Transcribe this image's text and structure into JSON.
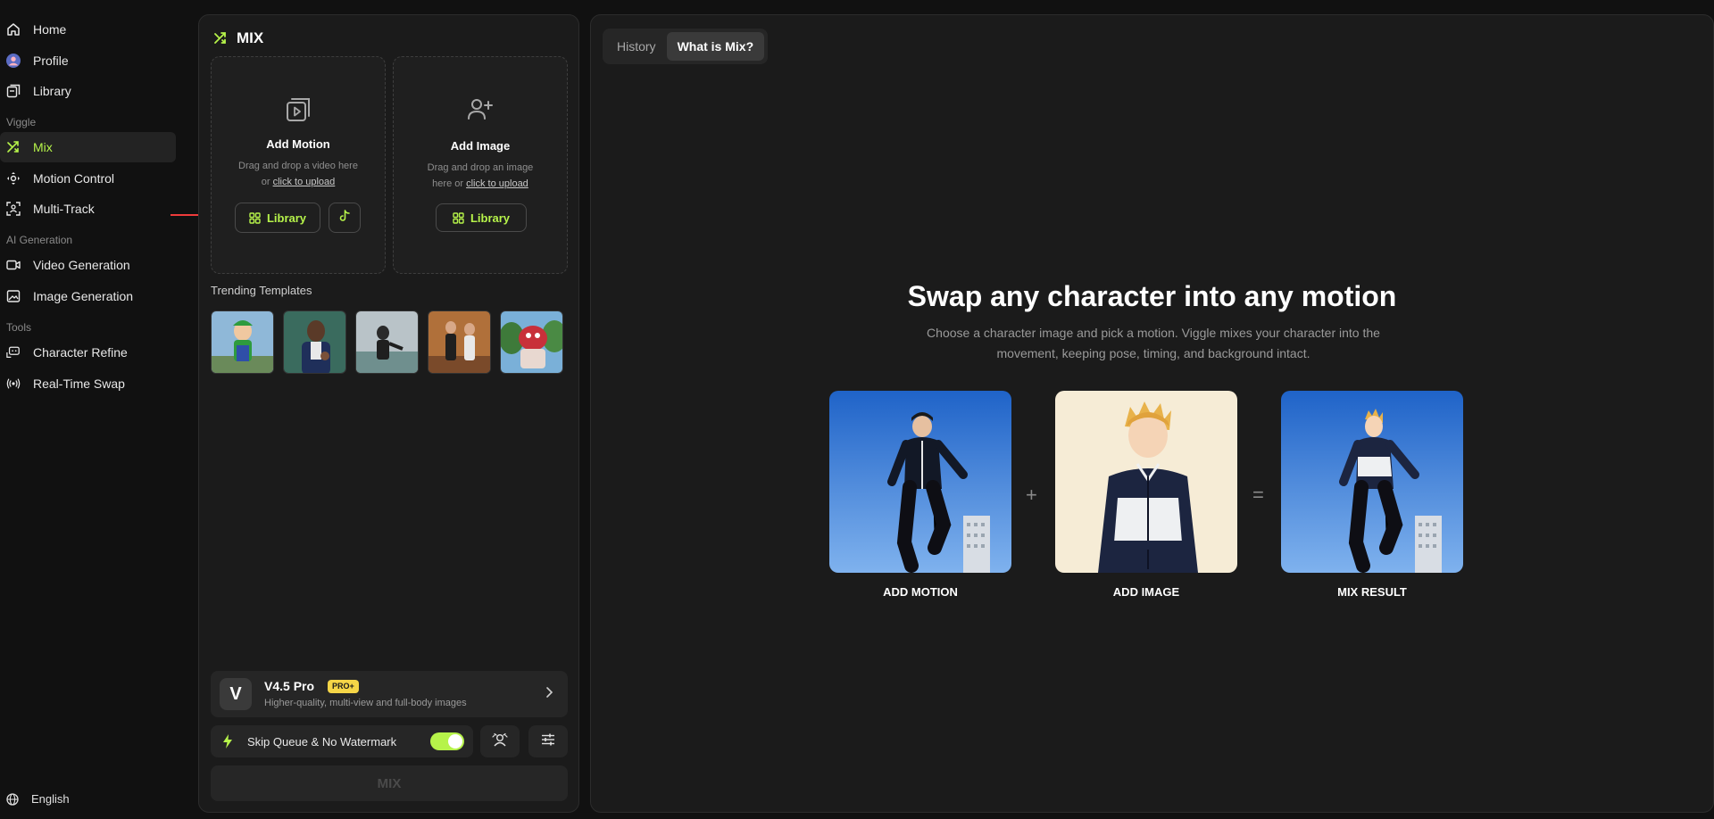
{
  "sidebar": {
    "items": [
      {
        "label": "Home",
        "icon": "home-icon"
      },
      {
        "label": "Profile",
        "icon": "avatar"
      },
      {
        "label": "Library",
        "icon": "library-icon"
      }
    ],
    "sections": [
      {
        "label": "Viggle",
        "items": [
          {
            "label": "Mix",
            "icon": "mix-icon",
            "active": true
          },
          {
            "label": "Motion Control",
            "icon": "motion-control-icon"
          },
          {
            "label": "Multi-Track",
            "icon": "multi-track-icon"
          }
        ]
      },
      {
        "label": "AI Generation",
        "items": [
          {
            "label": "Video Generation",
            "icon": "video-icon"
          },
          {
            "label": "Image Generation",
            "icon": "image-icon"
          }
        ]
      },
      {
        "label": "Tools",
        "items": [
          {
            "label": "Character Refine",
            "icon": "character-refine-icon"
          },
          {
            "label": "Real-Time Swap",
            "icon": "broadcast-icon"
          }
        ]
      }
    ],
    "language": "English"
  },
  "mix_panel": {
    "title": "MIX",
    "add_motion": {
      "title": "Add Motion",
      "sub_line1": "Drag and drop a video here",
      "sub_or": "or",
      "upload_link": "click to upload",
      "library_label": "Library"
    },
    "add_image": {
      "title": "Add Image",
      "sub_line1": "Drag and drop an image",
      "sub_line2": "here or",
      "upload_link": "click to upload",
      "library_label": "Library"
    },
    "trending_label": "Trending Templates",
    "model": {
      "logo": "V",
      "name": "V4.5 Pro",
      "badge": "PRO+",
      "description": "Higher-quality, multi-view and full-body images"
    },
    "skip_queue_label": "Skip Queue & No Watermark",
    "skip_queue_on": true,
    "mix_button": "MIX"
  },
  "right_panel": {
    "tabs": [
      {
        "label": "History",
        "active": false
      },
      {
        "label": "What is Mix?",
        "active": true
      }
    ],
    "hero_title": "Swap any character into any motion",
    "hero_sub": "Choose a character image and pick a motion. Viggle mixes your character into the movement, keeping pose, timing, and background intact.",
    "steps": [
      {
        "caption": "ADD MOTION"
      },
      {
        "caption": "ADD IMAGE"
      },
      {
        "caption": "MIX RESULT"
      }
    ],
    "plus": "+",
    "equals": "="
  },
  "colors": {
    "accent": "#b6f34a",
    "badge": "#f5d547",
    "background": "#111111",
    "panel": "#1b1b1b"
  }
}
